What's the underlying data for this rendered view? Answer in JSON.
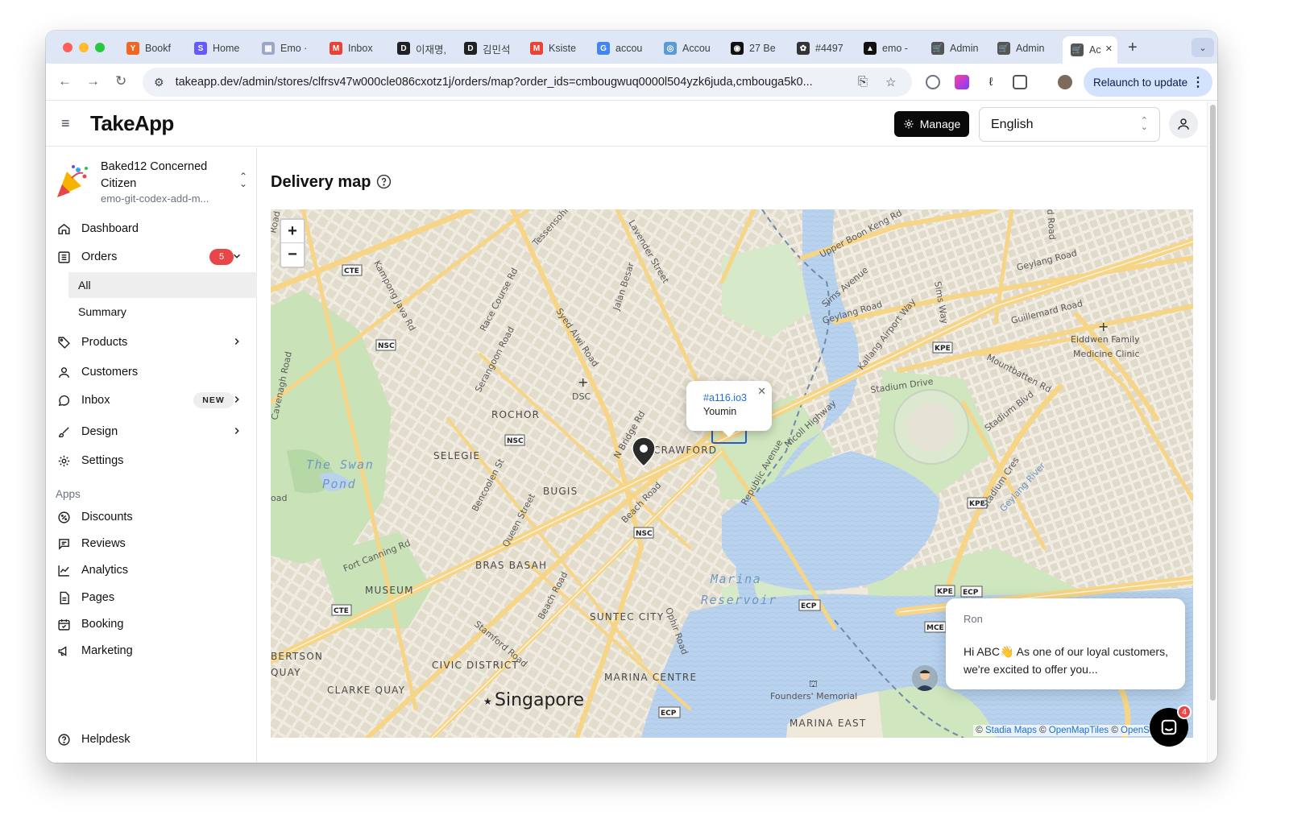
{
  "browser": {
    "tabs": [
      {
        "label": "Bookf",
        "icon": "Y",
        "color": "#f26522"
      },
      {
        "label": "Home",
        "icon": "S",
        "color": "#635bff"
      },
      {
        "label": "Emo ·",
        "icon": "▦",
        "color": "#9aa7c7"
      },
      {
        "label": "Inbox",
        "icon": "M",
        "color": "#ea4335"
      },
      {
        "label": "이재명,",
        "icon": "D",
        "color": "#202124"
      },
      {
        "label": "김민석",
        "icon": "D",
        "color": "#202124"
      },
      {
        "label": "Ksiste",
        "icon": "M",
        "color": "#ea4335"
      },
      {
        "label": "accou",
        "icon": "G",
        "color": "#4285f4"
      },
      {
        "label": "Accou",
        "icon": "◎",
        "color": "#5b9bd5"
      },
      {
        "label": "27 Be",
        "icon": "◉",
        "color": "#111111"
      },
      {
        "label": "#4497",
        "icon": "✿",
        "color": "#333333"
      },
      {
        "label": "emo -",
        "icon": "▲",
        "color": "#111111"
      },
      {
        "label": "Admin",
        "icon": "🛒",
        "color": "#555555"
      },
      {
        "label": "Admin",
        "icon": "🛒",
        "color": "#555555"
      },
      {
        "label": "Ac",
        "icon": "🛒",
        "color": "#555555"
      }
    ],
    "url": "takeapp.dev/admin/stores/clfrsv47w000cle086cxotz1j/orders/map?order_ids=cmbougwuq0000l504yzk6juda,cmbouga5k0...",
    "relaunch_label": "Relaunch to update"
  },
  "header": {
    "logo": "TakeApp",
    "manage_label": "Manage",
    "language": "English"
  },
  "sidebar": {
    "store_name": "Baked12 Concerned Citizen",
    "store_sub": "emo-git-codex-add-m...",
    "items": [
      {
        "label": "Dashboard"
      },
      {
        "label": "Orders",
        "badge": "5"
      },
      {
        "label": "Products"
      },
      {
        "label": "Customers"
      },
      {
        "label": "Inbox",
        "badge": "NEW"
      },
      {
        "label": "Design"
      },
      {
        "label": "Settings"
      }
    ],
    "orders_sub": [
      "All",
      "Summary"
    ],
    "apps_label": "Apps",
    "apps": [
      {
        "label": "Discounts"
      },
      {
        "label": "Reviews"
      },
      {
        "label": "Analytics"
      },
      {
        "label": "Pages"
      },
      {
        "label": "Booking"
      },
      {
        "label": "Marketing"
      }
    ],
    "helpdesk": "Helpdesk"
  },
  "main": {
    "title": "Delivery map",
    "popup": {
      "order": "#a116.io3",
      "name": "Youmin"
    },
    "attribution": {
      "prefix": "© ",
      "stadia": "Stadia Maps",
      "sep1": " © ",
      "omt": "OpenMapTiles",
      "sep2": " © ",
      "osm": "OpenSt"
    },
    "map_labels": {
      "rochor": "ROCHOR",
      "selegie": "SELEGIE",
      "bugis": "BUGIS",
      "crawford": "CRAWFORD",
      "bras_basah": "BRAS BASAH",
      "museum": "MUSEUM",
      "suntec": "SUNTEC CITY",
      "civic": "CIVIC DISTRICT",
      "marina_centre": "MARINA CENTRE",
      "clarke_quay": "CLARKE QUAY",
      "singapore": "Singapore",
      "marina_east": "MARINA EAST",
      "swan_pond_1": "The Swan",
      "swan_pond_2": "Pond",
      "reservoir_1": "Marina",
      "reservoir_2": "Reservoir",
      "robertson_1": "BERTSON",
      "robertson_2": "QUAY",
      "dsc": "DSC",
      "eiddwen_1": "Eiddwen Family",
      "eiddwen_2": "Medicine Clinic",
      "founders": "Founders' Memorial",
      "stadium_drive": "Stadium Drive",
      "nicoll": "Nicoll Highway",
      "republic": "Republic Avenue",
      "geylang_road": "Geylang Road",
      "geylang_road2": "Geylang Road",
      "guillemard": "Guillemard Road",
      "upper_boon": "Upper Boon Keng Rd",
      "sims_ave": "Sims Avenue",
      "sims_way": "Sims Way",
      "kallang_airport": "Kallang Airport Way",
      "mountbatten": "Mountbatten Rd",
      "stadium_blvd": "Stadium Blvd",
      "stadium_cres": "Stadium Cres",
      "geylang_river": "Geylang River",
      "lavender": "Lavender Street",
      "jalan_besar": "Jalan Besar",
      "syed_alwi": "Syed Alwi Road",
      "race_course": "Race Course Rd",
      "serangoon": "Serangoon Road",
      "tessensohn": "Tessensohn",
      "kampong_java": "Kampong Java Rd",
      "cavenagh": "Cavenagh Road",
      "n_bridge": "N Bridge Rd",
      "beach_road": "Beach Road",
      "beach_road2": "Beach Road",
      "bencoolen": "Bencoolen St",
      "queen": "Queen Street",
      "fort_canning": "Fort Canning Rd",
      "stamford": "Stamford Road",
      "ophir": "Ophir Road",
      "road_left": "Road",
      "road_left2": "oad",
      "d_road": "d Road",
      "cte1": "CTE",
      "cte2": "CTE",
      "nsc1": "NSC",
      "nsc2": "NSC",
      "nsc3": "NSC",
      "kpe1": "KPE",
      "kpe2": "KPE",
      "kpe3": "KPE",
      "ecp1": "ECP",
      "ecp2": "ECP",
      "ecp3": "ECP",
      "mce": "MCE"
    }
  },
  "chat": {
    "sender": "Ron",
    "message": "Hi ABC👋 As one of our loyal customers, we're excited to offer you...",
    "unread": "4"
  }
}
